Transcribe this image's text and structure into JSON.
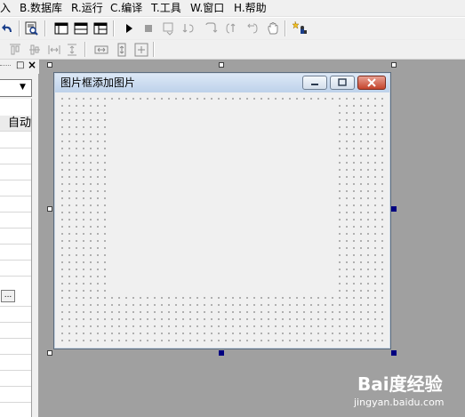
{
  "menu": [
    {
      "label": "入"
    },
    {
      "label": "B.数据库"
    },
    {
      "label": "R.运行"
    },
    {
      "label": "C.编译"
    },
    {
      "label": "T.工具"
    },
    {
      "label": "W.窗口"
    },
    {
      "label": "H.帮助"
    }
  ],
  "left_panel": {
    "header_glyph_max": "□",
    "header_glyph_close": "×",
    "combo_arrow": "▼",
    "property_value": "自动",
    "ellipsis": "..."
  },
  "designer": {
    "window_title": "图片框添加图片"
  },
  "watermark": {
    "brand": "Bai度经验",
    "url": "jingyan.baidu.com"
  },
  "colors": {
    "workspace": "#a0a0a0",
    "window_bg": "#f0f0f0",
    "titlebar": "#bdd1ea",
    "selection_handle": "#000080"
  },
  "icons": {
    "undo": "undo-icon",
    "find": "find-icon",
    "run": "run-icon",
    "stop": "stop-icon",
    "hand": "hand-icon",
    "wizard": "wizard-icon"
  }
}
